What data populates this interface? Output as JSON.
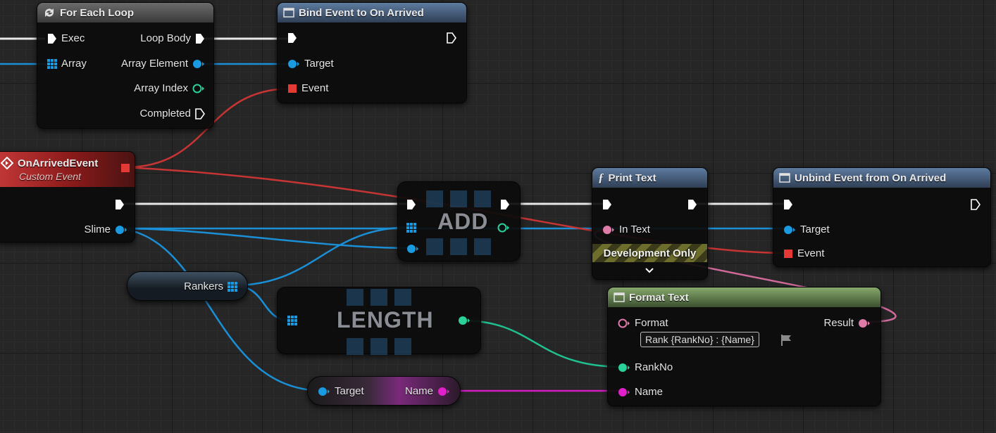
{
  "nodes": {
    "for_each_loop": {
      "title": "For Each Loop",
      "exec_in": "Exec",
      "array_in": "Array",
      "loop_body": "Loop Body",
      "array_element": "Array Element",
      "array_index": "Array Index",
      "completed": "Completed"
    },
    "bind_event": {
      "title": "Bind Event to On Arrived",
      "target": "Target",
      "event": "Event"
    },
    "custom_event": {
      "title": "OnArrivedEvent",
      "subtitle": "Custom Event",
      "slime": "Slime"
    },
    "add_node": {
      "title": "ADD"
    },
    "print_text": {
      "title": "Print Text",
      "in_text": "In Text",
      "banner": "Development Only"
    },
    "unbind_event": {
      "title": "Unbind Event from On Arrived",
      "target": "Target",
      "event": "Event"
    },
    "rankers_var": {
      "label": "Rankers"
    },
    "length_node": {
      "title": "LENGTH"
    },
    "format_text": {
      "title": "Format Text",
      "format": "Format",
      "format_value": "Rank {RankNo} : {Name}",
      "result": "Result",
      "rank_no": "RankNo",
      "name": "Name"
    },
    "get_name": {
      "target": "Target",
      "name": "Name"
    }
  },
  "colors": {
    "exec": "#ffffff",
    "object": "#1a9ae0",
    "int": "#2ad29a",
    "delegate": "#e53935",
    "text": "#e07aa8",
    "string": "#e020c8"
  }
}
